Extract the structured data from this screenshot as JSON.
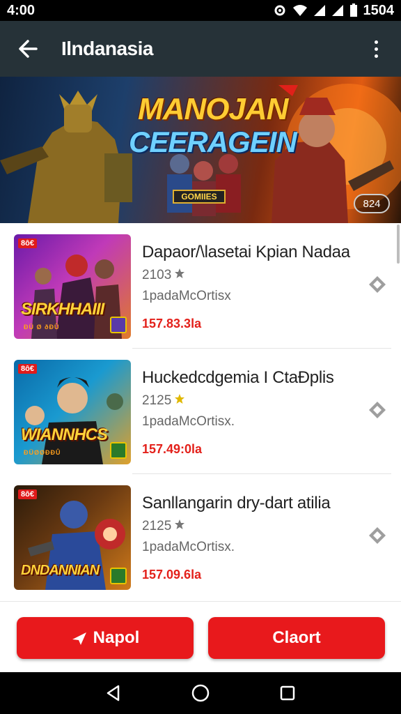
{
  "status_bar": {
    "time": "4:00",
    "right_text": "1504"
  },
  "app_bar": {
    "title": "Ilndanasia"
  },
  "banner": {
    "title_line1": "MANOJAN",
    "title_line2": "CEERAGEIN",
    "badge": "GOMIIES",
    "counter": "824"
  },
  "items": [
    {
      "tag": "8ô€",
      "thumb_caption": "SIRKHHAIII",
      "thumb_sub": "ÐÜ Ø ðÐÛ",
      "title": "Dapaor/\\lasetai Kpian Nadaa",
      "rating": "2103",
      "subtitle": "1padaMcOrtisx",
      "price": "157.83.3la"
    },
    {
      "tag": "8ô€",
      "thumb_caption": "WIANNHCS",
      "thumb_sub": "ÐÜØØÐÐÛ",
      "title": "Huckedcdgemia I CtaÐplis",
      "rating": "2125",
      "subtitle": "1padaMcOrtisx.",
      "price": "157.49:0la"
    },
    {
      "tag": "8ô€",
      "thumb_caption": "DNDANNIAN",
      "thumb_sub": "",
      "title": "Sanllangarin dry-dart atilia",
      "rating": "2125",
      "subtitle": "1padaMcOrtisx.",
      "price": "157.09.6la"
    }
  ],
  "footer": {
    "left_button": "Napol",
    "right_button": "Claort"
  },
  "colors": {
    "accent_red": "#e8191c",
    "price_red": "#e3211b",
    "app_bar": "#263238"
  }
}
